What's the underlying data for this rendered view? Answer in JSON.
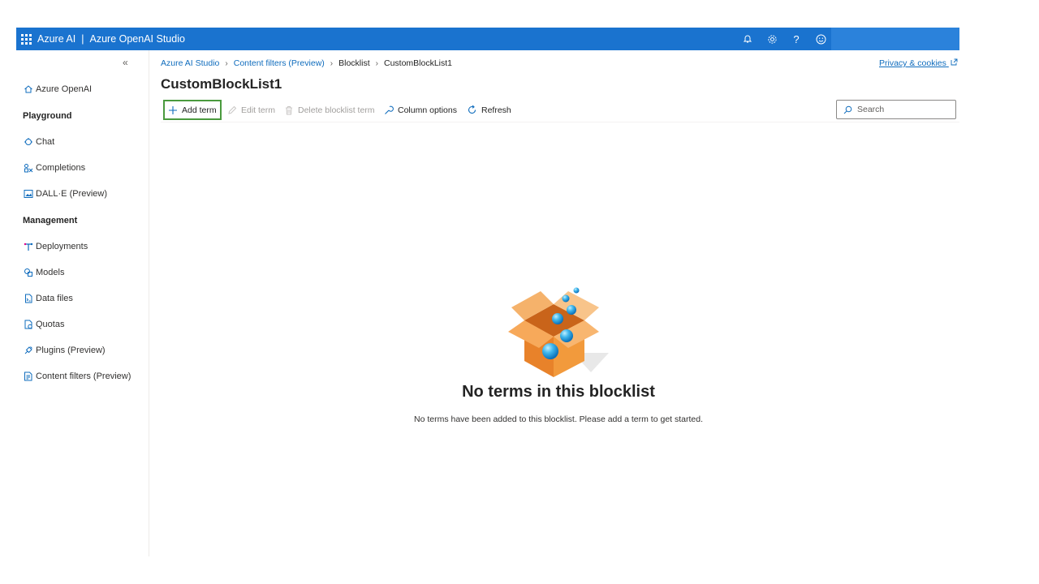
{
  "topbar": {
    "product": "Azure AI",
    "app": "Azure OpenAI Studio",
    "icons": [
      "bell-icon",
      "gear-icon",
      "help-icon",
      "smiley-icon"
    ]
  },
  "sidebar": {
    "collapse_glyph": "«",
    "home": "Azure OpenAI",
    "sections": {
      "playground": "Playground",
      "management": "Management"
    },
    "playground_items": [
      {
        "label": "Chat",
        "icon": "chat-icon"
      },
      {
        "label": "Completions",
        "icon": "completions-icon"
      },
      {
        "label": "DALL·E (Preview)",
        "icon": "image-icon"
      }
    ],
    "management_items": [
      {
        "label": "Deployments",
        "icon": "deployments-icon"
      },
      {
        "label": "Models",
        "icon": "models-icon"
      },
      {
        "label": "Data files",
        "icon": "data-files-icon"
      },
      {
        "label": "Quotas",
        "icon": "quotas-icon"
      },
      {
        "label": "Plugins (Preview)",
        "icon": "plugin-icon"
      },
      {
        "label": "Content filters (Preview)",
        "icon": "content-filter-icon"
      }
    ]
  },
  "breadcrumb": {
    "items": [
      "Azure AI Studio",
      "Content filters (Preview)",
      "Blocklist",
      "CustomBlockList1"
    ]
  },
  "privacy": "Privacy & cookies",
  "page": {
    "title": "CustomBlockList1"
  },
  "toolbar": {
    "add_term": "Add term",
    "edit_term": "Edit term",
    "delete_term": "Delete blocklist term",
    "column_options": "Column options",
    "refresh": "Refresh",
    "search_placeholder": "Search"
  },
  "empty_state": {
    "title": "No terms in this blocklist",
    "description": "No terms have been added to this blocklist. Please add a term to get started."
  },
  "colors": {
    "topbar": "#1a73cf",
    "link": "#0f6cbd",
    "add_highlight": "#4a9a3e"
  }
}
